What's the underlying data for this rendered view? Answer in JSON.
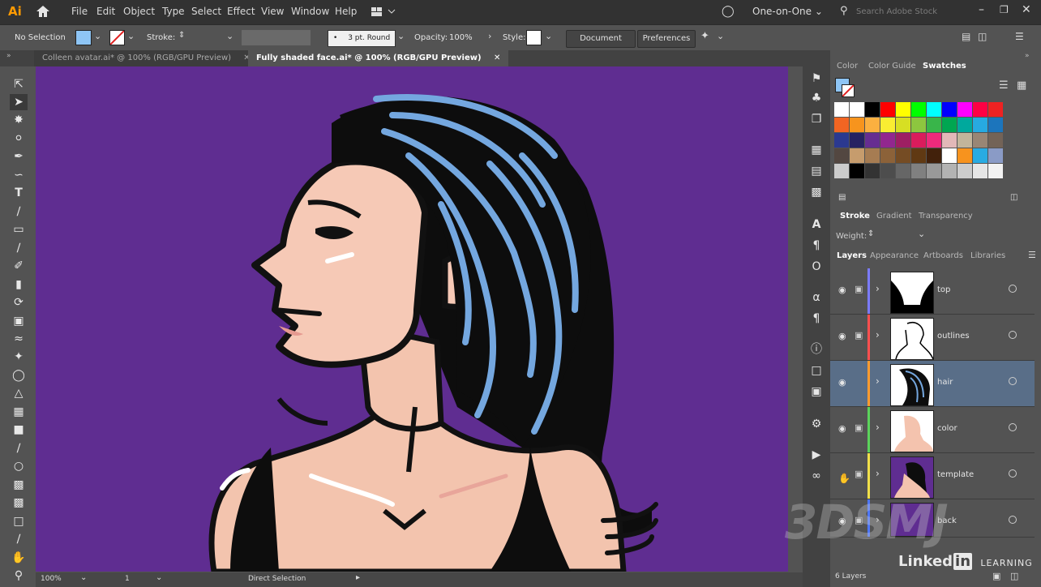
{
  "app": {
    "logo": "Ai",
    "workspace": "One-on-One",
    "search_placeholder": "Search Adobe Stock"
  },
  "menu": [
    "File",
    "Edit",
    "Object",
    "Type",
    "Select",
    "Effect",
    "View",
    "Window",
    "Help"
  ],
  "control": {
    "selection": "No Selection",
    "stroke_label": "Stroke:",
    "brush": "3 pt. Round",
    "opacity_label": "Opacity:",
    "opacity": "100%",
    "style_label": "Style:",
    "document_setup": "Document Setup",
    "preferences": "Preferences"
  },
  "tabs": [
    {
      "label": "Colleen avatar.ai* @ 100% (RGB/GPU Preview)",
      "active": false
    },
    {
      "label": "Fully shaded face.ai* @ 100% (RGB/GPU Preview)",
      "active": true
    }
  ],
  "status": {
    "zoom": "100%",
    "artboard": "1",
    "tool": "Direct Selection"
  },
  "swatch_panel": {
    "tabs": [
      "Color",
      "Color Guide",
      "Swatches"
    ],
    "active": "Swatches"
  },
  "stroke_panel": {
    "tabs": [
      "Stroke",
      "Gradient",
      "Transparency"
    ],
    "weight_label": "Weight:"
  },
  "layers_panel": {
    "tabs": [
      "Layers",
      "Appearance",
      "Artboards",
      "Libraries"
    ],
    "footer": "6 Layers",
    "layers": [
      {
        "name": "top",
        "color": "#7b7bff"
      },
      {
        "name": "outlines",
        "color": "#ff4f4f"
      },
      {
        "name": "hair",
        "color": "#ff9b2f"
      },
      {
        "name": "color",
        "color": "#5bd35b"
      },
      {
        "name": "template",
        "color": "#f1e04a"
      },
      {
        "name": "back",
        "color": "#4f78ff"
      }
    ]
  },
  "watermark": {
    "brand": "Linked",
    "brand_in": "in",
    "suffix": "LEARNING",
    "logo": "3DSMJ"
  },
  "colors": {
    "canvas": "#5f2d91",
    "skin": "#f6c9b6",
    "hair": "#75a8e0",
    "panel": "#535353"
  }
}
